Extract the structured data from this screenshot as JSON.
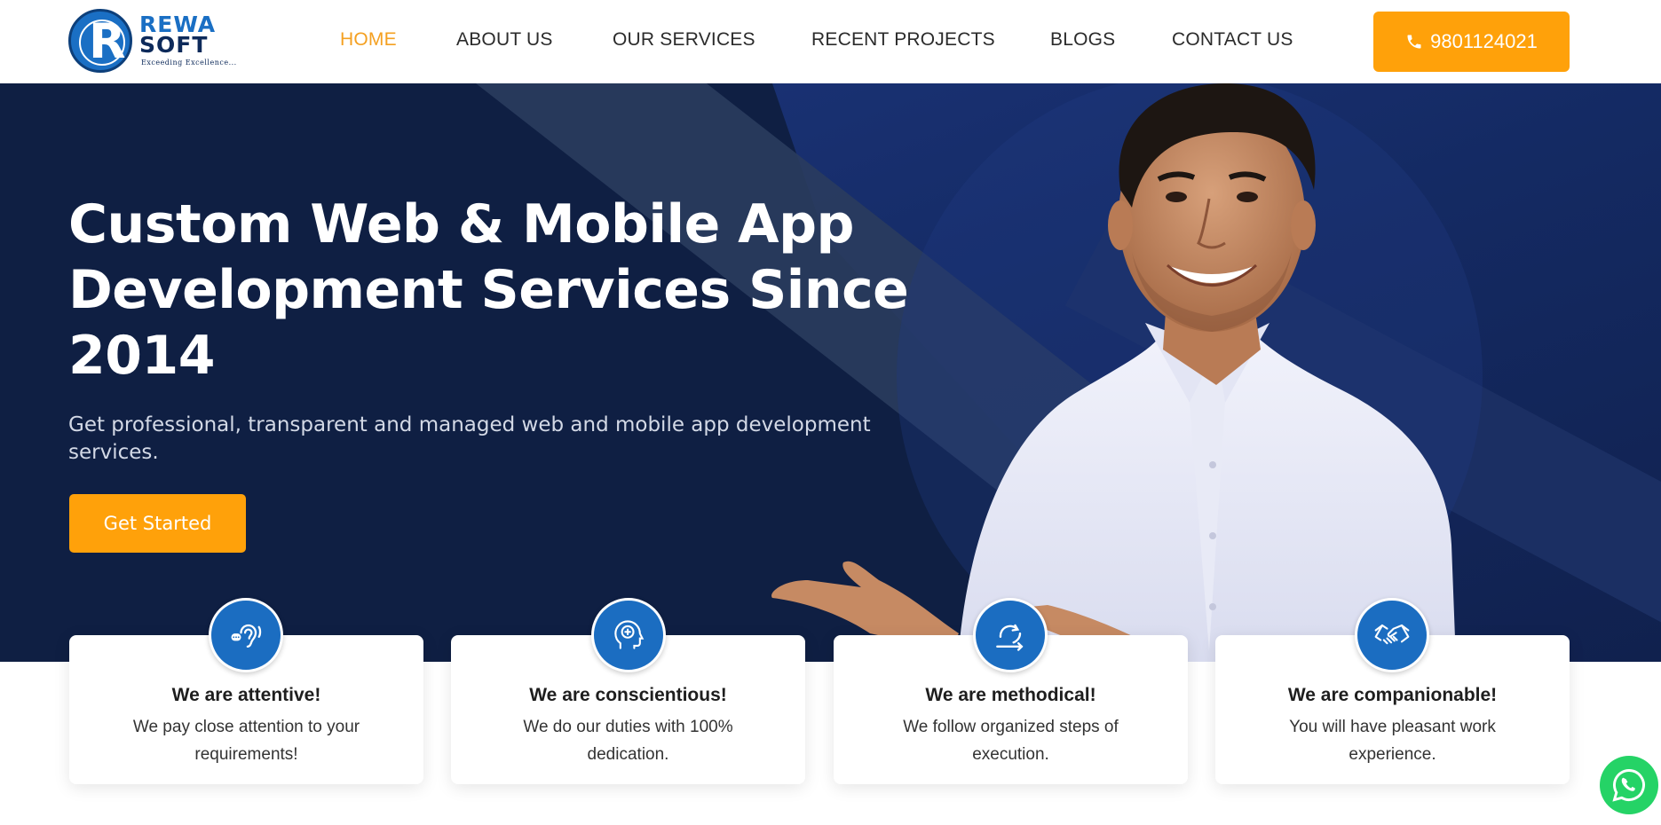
{
  "brand": {
    "logo_letter": "R",
    "name_line1": "REWA",
    "name_line2": "SOFT",
    "tagline": "Exceeding Excellence...",
    "primary_color": "#1a6fc4",
    "accent_color": "#ffa10a"
  },
  "nav": {
    "items": [
      {
        "label": "HOME",
        "active": true
      },
      {
        "label": "ABOUT US",
        "active": false
      },
      {
        "label": "OUR SERVICES",
        "active": false
      },
      {
        "label": "RECENT PROJECTS",
        "active": false
      },
      {
        "label": "BLOGS",
        "active": false
      },
      {
        "label": "CONTACT US",
        "active": false
      }
    ],
    "phone": {
      "label": "9801124021",
      "icon": "phone-icon"
    }
  },
  "hero": {
    "title": "Custom Web & Mobile App Development Services Since 2014",
    "subtitle": "Get professional, transparent and managed web and mobile app development services.",
    "cta_label": "Get Started",
    "background_color": "#0f1f43"
  },
  "features": [
    {
      "icon": "listening-ear-icon",
      "title": "We are attentive!",
      "desc": "We pay close attention to your requirements!"
    },
    {
      "icon": "brain-head-icon",
      "title": "We are conscientious!",
      "desc": "We do our duties with 100% dedication."
    },
    {
      "icon": "process-cycle-icon",
      "title": "We are methodical!",
      "desc": "We follow organized steps of execution."
    },
    {
      "icon": "handshake-icon",
      "title": "We are companionable!",
      "desc": "You will have pleasant work experience."
    }
  ],
  "floating": {
    "whatsapp_icon": "whatsapp-icon"
  }
}
